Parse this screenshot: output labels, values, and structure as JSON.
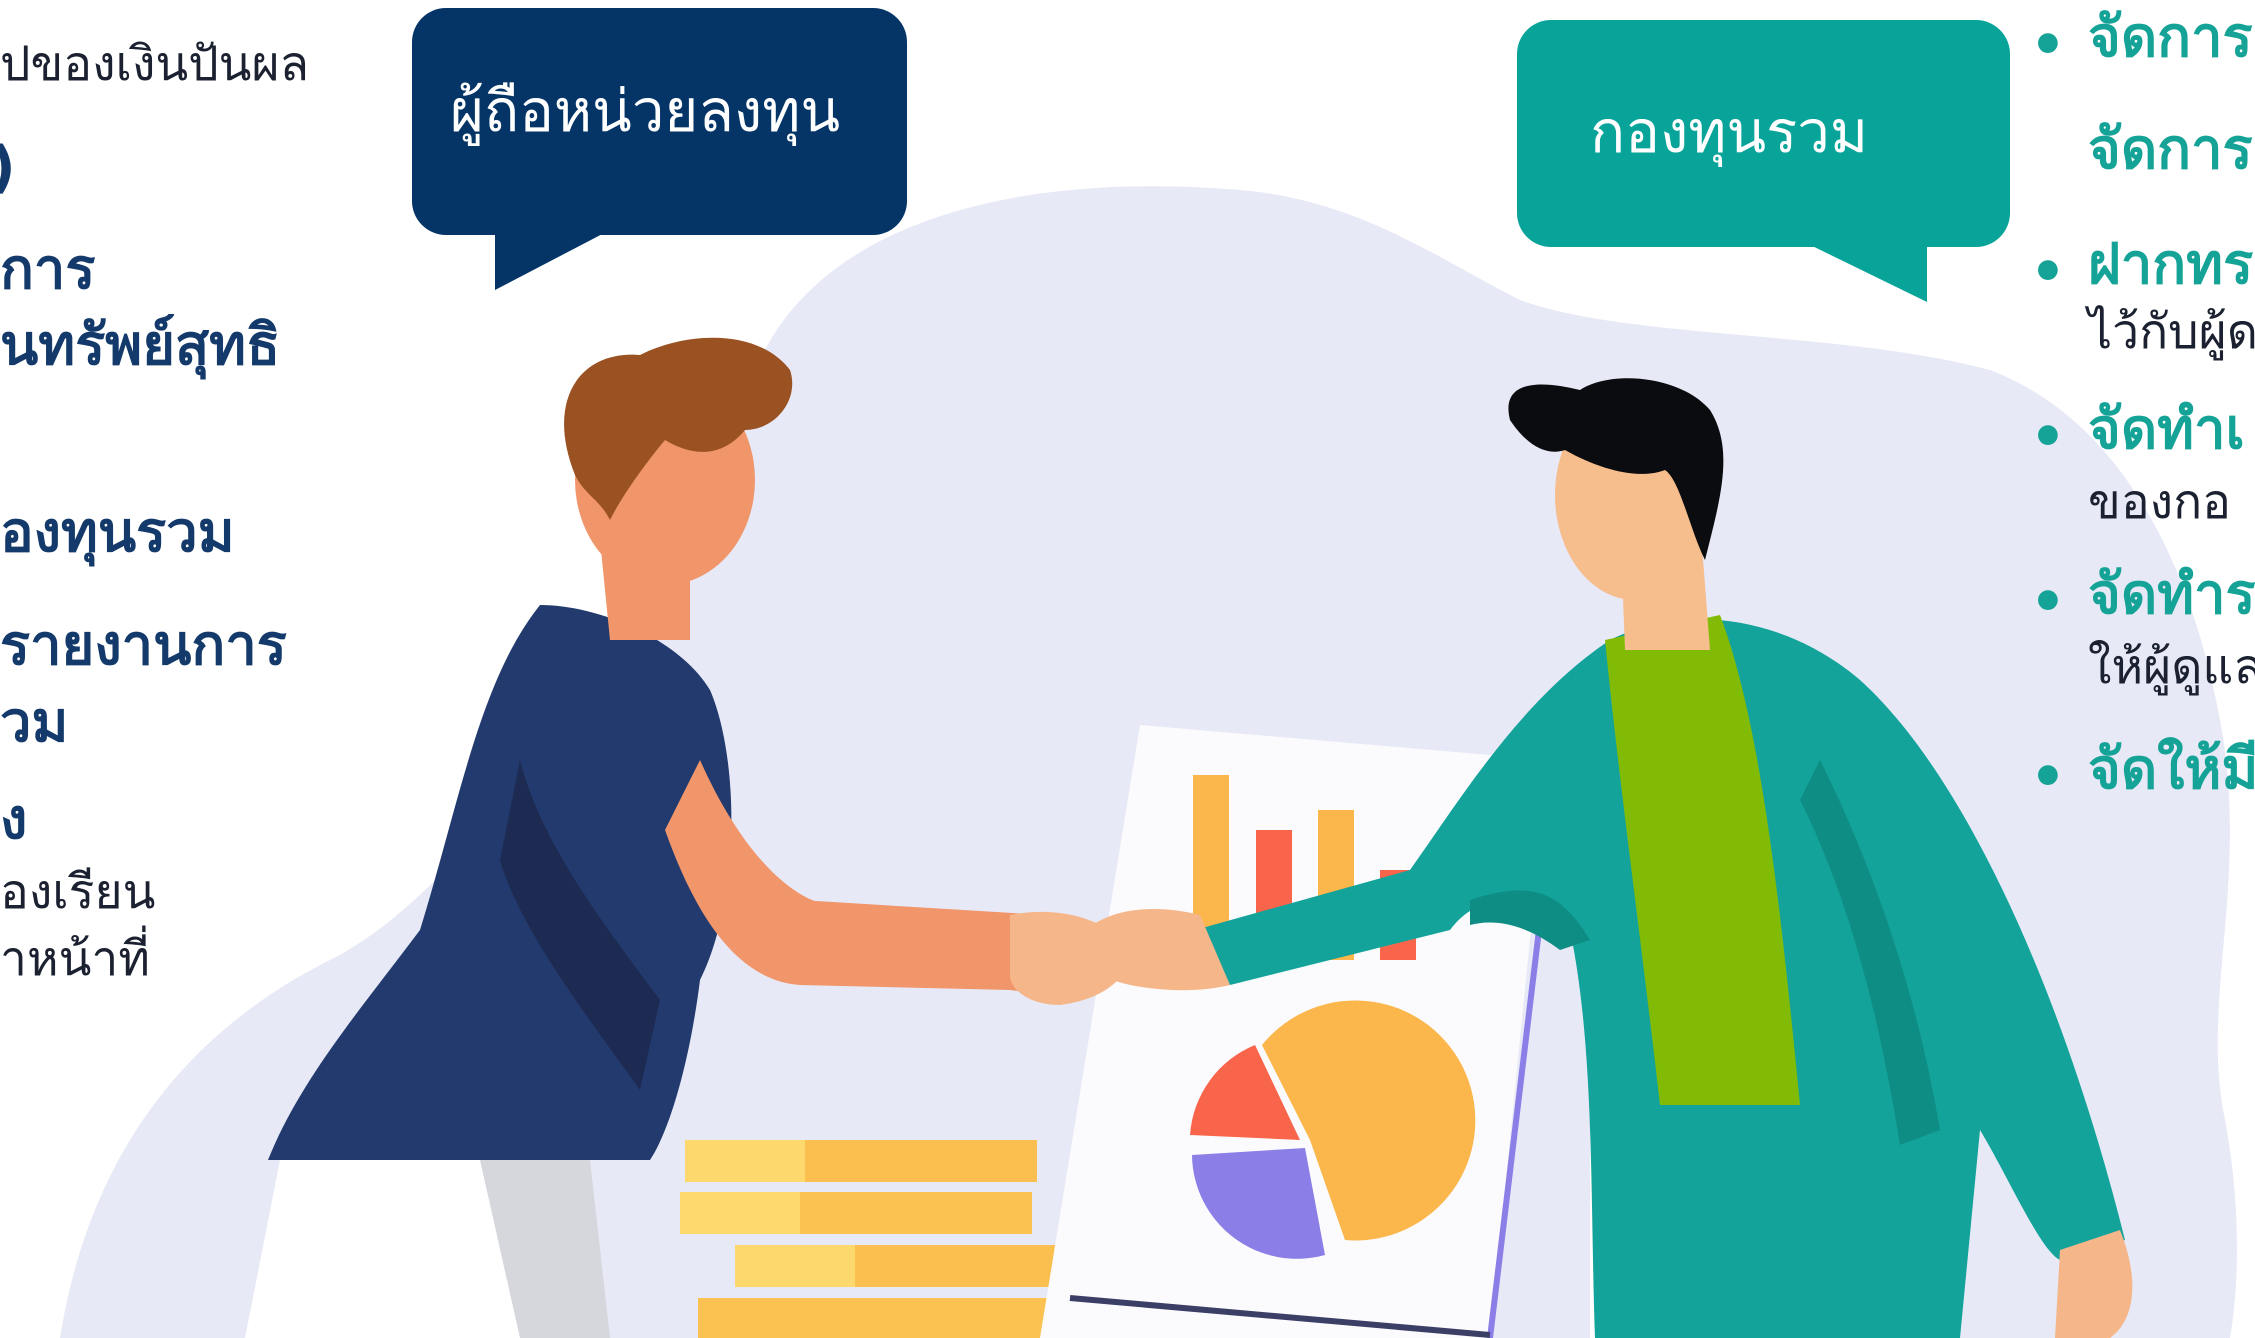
{
  "colors": {
    "navy": "#053566",
    "teal": "#08a49a",
    "blob": "#e7e9f6",
    "green_text": "#14a396",
    "navy_text": "#133a6a"
  },
  "left_panel": {
    "line_1": "ปของเงินปันผล",
    "line_2": ")",
    "line_3": "การ",
    "line_4": "นทรัพย์สุทธิ",
    "line_5": "องทุนรวม",
    "line_6": "รายงานการ",
    "line_7": "วม",
    "line_8": "ง",
    "line_9": "องเรียน",
    "line_10": "าหน้าที่"
  },
  "bubbles": {
    "investor": "ผู้ถือหน่วยลงทุน",
    "fund": "กองทุนรวม"
  },
  "right_panel": {
    "items": [
      {
        "bullet": "•",
        "title": "จัดการ"
      },
      {
        "bullet": "",
        "title": "จัดการ"
      },
      {
        "bullet": "•",
        "title": "ฝากทร",
        "sub": "ไว้กับผู้ด"
      },
      {
        "bullet": "•",
        "title": "จัดทำเ",
        "sub": "ของกอ"
      },
      {
        "bullet": "•",
        "title": "จัดทำร",
        "sub": "ให้ผู้ดูแล"
      },
      {
        "bullet": "•",
        "title": "จัดให้มี"
      }
    ]
  }
}
